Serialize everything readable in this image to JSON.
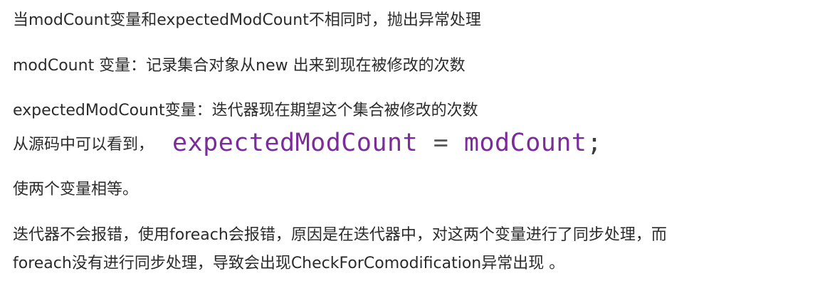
{
  "lines": {
    "line1": "当modCount变量和expectedModCount不相同时，抛出异常处理",
    "line2": "modCount 变量：记录集合对象从new 出来到现在被修改的次数",
    "line3": "expectedModCount变量：迭代器现在期望这个集合被修改的次数",
    "line4_prefix": "从源码中可以看到，",
    "line5": "使两个变量相等。",
    "line6": "迭代器不会报错，使用foreach会报错，原因是在迭代器中，对这两个变量进行了同步处理，而",
    "line7": "foreach没有进行同步处理，导致会出现CheckForComodification异常出现 。"
  },
  "code_snippet": {
    "left_ident": "expectedModCount",
    "operator": "=",
    "right_ident": "modCount",
    "terminator": ";"
  },
  "colors": {
    "text": "#2b2b2b",
    "code_identifier": "#7b2c9a",
    "background": "#ffffff"
  }
}
